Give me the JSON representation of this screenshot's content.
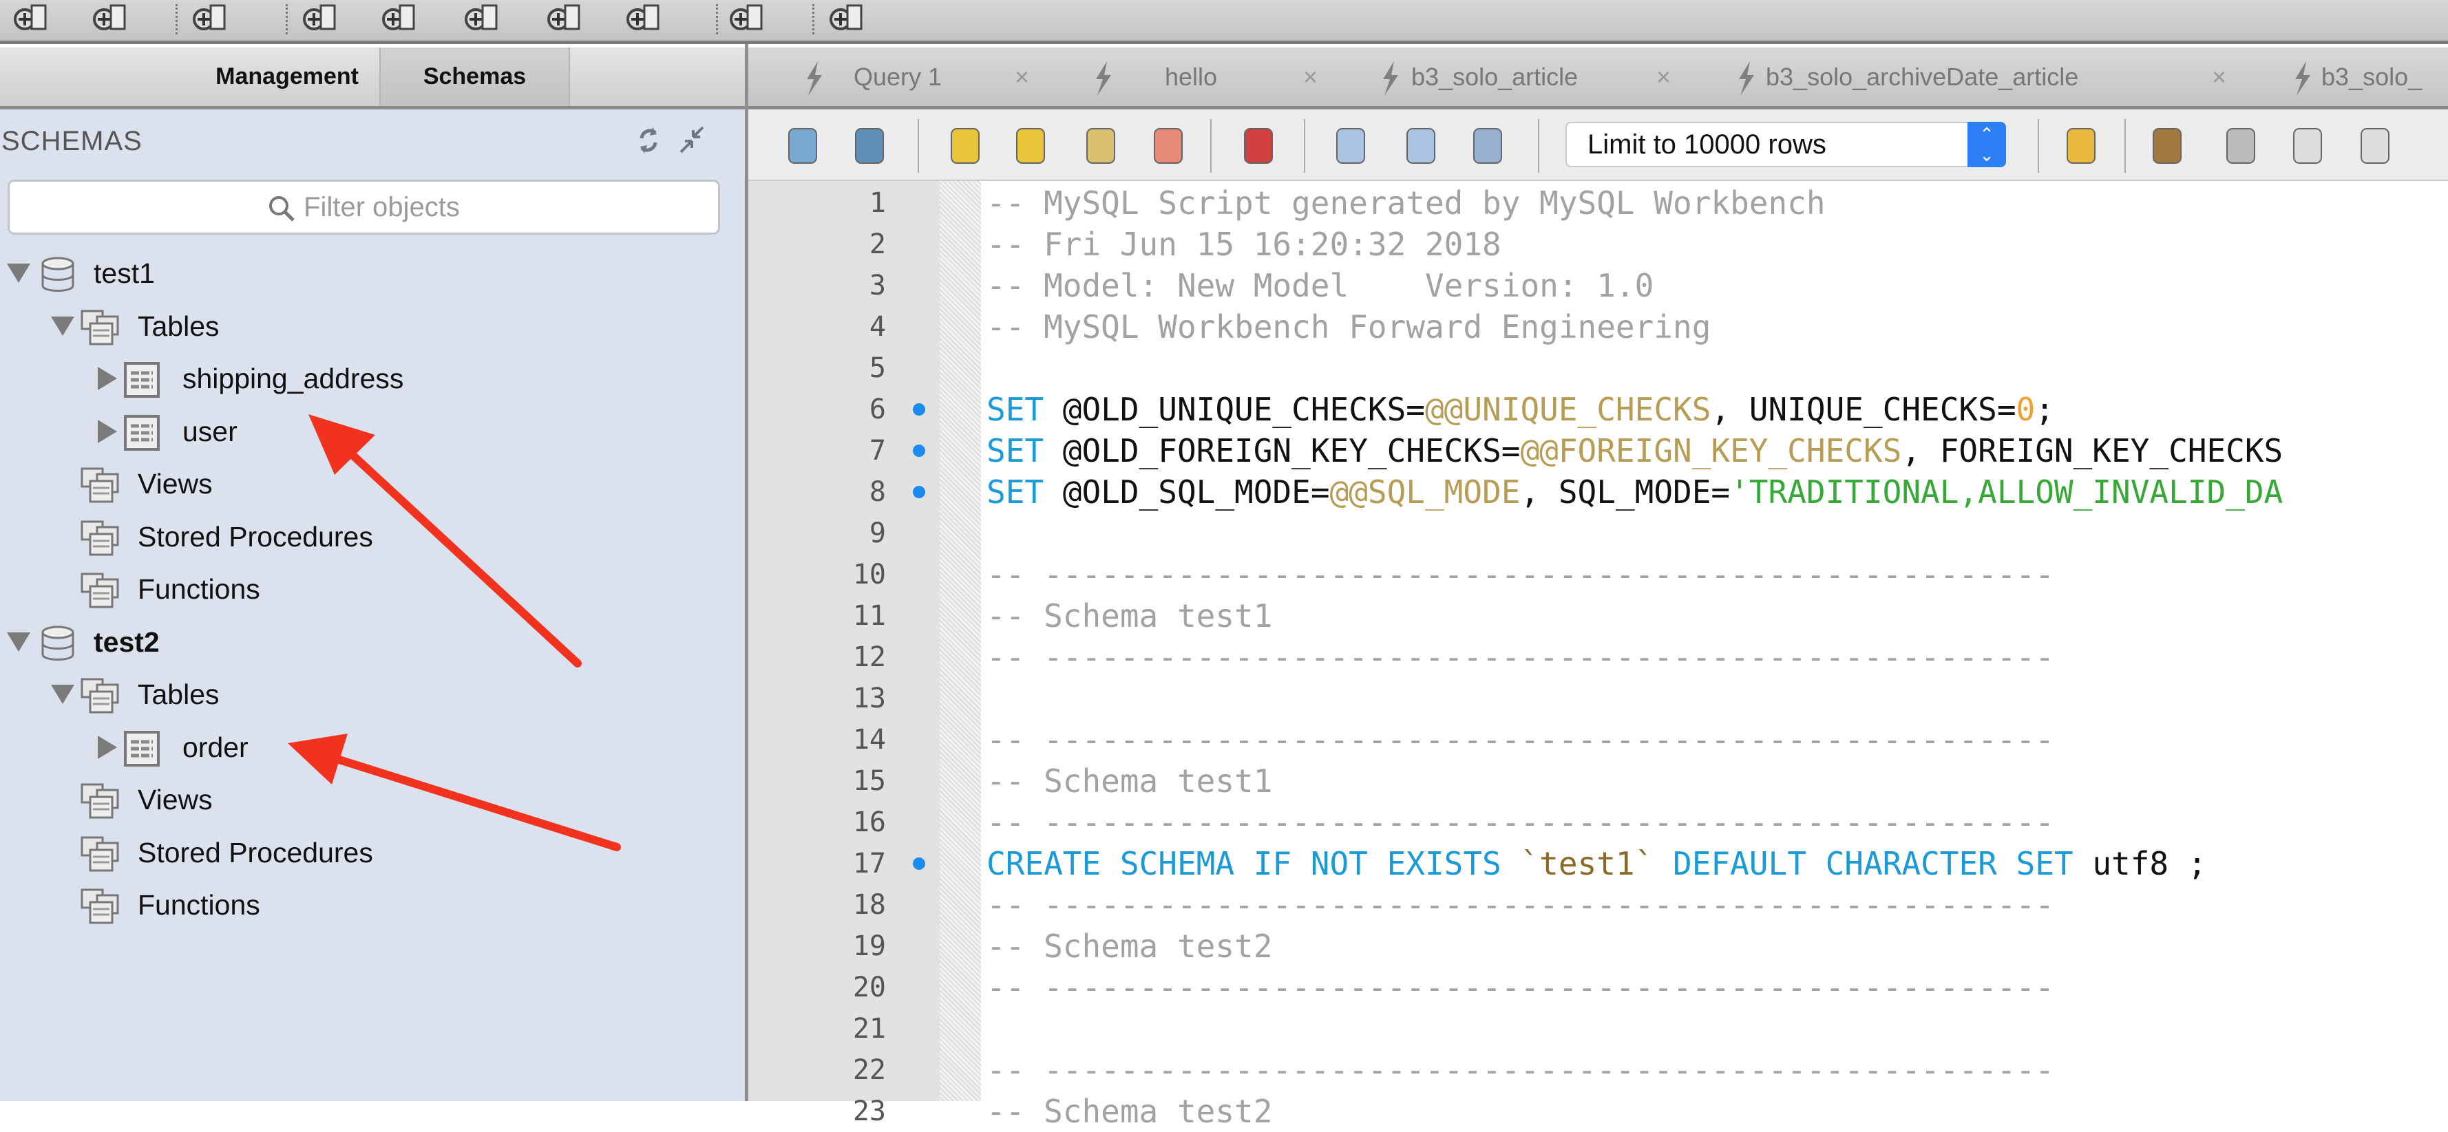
{
  "toolbar": {
    "icons": [
      "new-sql-tab-icon",
      "open-sql-file-icon",
      "inspector-icon",
      "create-schema-icon",
      "create-table-icon",
      "create-view-icon",
      "create-procedure-icon",
      "create-function-icon",
      "search-table-data-icon",
      "reconnect-icon"
    ]
  },
  "sidebar": {
    "tabs": [
      {
        "label": "Management"
      },
      {
        "label": "Schemas",
        "selected": true
      }
    ],
    "title": "SCHEMAS",
    "filter_placeholder": "Filter objects",
    "tree": [
      {
        "level": 0,
        "type": "schema",
        "label": "test1",
        "expanded": true,
        "bold": false
      },
      {
        "level": 1,
        "type": "folder",
        "label": "Tables",
        "expanded": true
      },
      {
        "level": 2,
        "type": "table",
        "label": "shipping_address",
        "expanded": false
      },
      {
        "level": 2,
        "type": "table",
        "label": "user",
        "expanded": false
      },
      {
        "level": 1,
        "type": "folder",
        "label": "Views"
      },
      {
        "level": 1,
        "type": "folder",
        "label": "Stored Procedures"
      },
      {
        "level": 1,
        "type": "folder",
        "label": "Functions"
      },
      {
        "level": 0,
        "type": "schema",
        "label": "test2",
        "expanded": true,
        "bold": true
      },
      {
        "level": 1,
        "type": "folder",
        "label": "Tables",
        "expanded": true
      },
      {
        "level": 2,
        "type": "table",
        "label": "order",
        "expanded": false
      },
      {
        "level": 1,
        "type": "folder",
        "label": "Views"
      },
      {
        "level": 1,
        "type": "folder",
        "label": "Stored Procedures"
      },
      {
        "level": 1,
        "type": "folder",
        "label": "Functions"
      }
    ]
  },
  "editor": {
    "tabs": [
      {
        "label": "Query 1"
      },
      {
        "label": "hello"
      },
      {
        "label": "b3_solo_article"
      },
      {
        "label": "b3_solo_archiveDate_article"
      },
      {
        "label": "b3_solo_"
      }
    ],
    "limit_select": "Limit to 10000 rows",
    "toolbar_icons": [
      "open-file-icon",
      "save-icon",
      "execute-icon",
      "execute-current-icon",
      "explain-icon",
      "stop-icon",
      "toggle-error-stop-icon",
      "commit-icon",
      "rollback-icon",
      "autocommit-icon",
      "add-snippet-icon",
      "beautify-icon",
      "find-icon",
      "invisible-chars-icon",
      "word-wrap-icon"
    ],
    "colors": {
      "keyword": "#1a9ad6",
      "variable": "#b79c54",
      "number": "#f0a030",
      "string": "#36a836",
      "comment": "#a2a2a2",
      "marker": "#1a8cf0",
      "annotation": "#f0321e"
    },
    "lines": [
      {
        "n": "1",
        "tokens": [
          [
            "-- MySQL Script generated by MySQL Workbench",
            "cm"
          ]
        ]
      },
      {
        "n": "2",
        "tokens": [
          [
            "-- Fri Jun 15 16:20:32 2018",
            "cm"
          ]
        ]
      },
      {
        "n": "3",
        "tokens": [
          [
            "-- Model: New Model    Version: 1.0",
            "cm"
          ]
        ]
      },
      {
        "n": "4",
        "tokens": [
          [
            "-- MySQL Workbench Forward Engineering",
            "cm"
          ]
        ]
      },
      {
        "n": "5",
        "tokens": []
      },
      {
        "n": "6",
        "marker": true,
        "tokens": [
          [
            "SET",
            "kw"
          ],
          [
            " @OLD_UNIQUE_CHECKS=",
            "tx"
          ],
          [
            "@@UNIQUE_CHECKS",
            "var"
          ],
          [
            ", UNIQUE_CHECKS=",
            "tx"
          ],
          [
            "0",
            "num"
          ],
          [
            ";",
            "tx"
          ]
        ]
      },
      {
        "n": "7",
        "marker": true,
        "tokens": [
          [
            "SET",
            "kw"
          ],
          [
            " @OLD_FOREIGN_KEY_CHECKS=",
            "tx"
          ],
          [
            "@@FOREIGN_KEY_CHECKS",
            "var"
          ],
          [
            ", FOREIGN_KEY_CHECKS",
            "tx"
          ]
        ]
      },
      {
        "n": "8",
        "marker": true,
        "tokens": [
          [
            "SET",
            "kw"
          ],
          [
            " @OLD_SQL_MODE=",
            "tx"
          ],
          [
            "@@SQL_MODE",
            "var"
          ],
          [
            ", SQL_MODE=",
            "tx"
          ],
          [
            "'TRADITIONAL,ALLOW_INVALID_DA",
            "str"
          ]
        ]
      },
      {
        "n": "9",
        "tokens": []
      },
      {
        "n": "10",
        "tokens": [
          [
            "-- -----------------------------------------------------",
            "cm"
          ]
        ]
      },
      {
        "n": "11",
        "tokens": [
          [
            "-- Schema test1",
            "cm"
          ]
        ]
      },
      {
        "n": "12",
        "tokens": [
          [
            "-- -----------------------------------------------------",
            "cm"
          ]
        ]
      },
      {
        "n": "13",
        "tokens": []
      },
      {
        "n": "14",
        "tokens": [
          [
            "-- -----------------------------------------------------",
            "cm"
          ]
        ]
      },
      {
        "n": "15",
        "tokens": [
          [
            "-- Schema test1",
            "cm"
          ]
        ]
      },
      {
        "n": "16",
        "tokens": [
          [
            "-- -----------------------------------------------------",
            "cm"
          ]
        ]
      },
      {
        "n": "17",
        "marker": true,
        "tokens": [
          [
            "CREATE SCHEMA IF NOT EXISTS ",
            "kw"
          ],
          [
            "`test1`",
            "bt"
          ],
          [
            " DEFAULT CHARACTER SET ",
            "kw"
          ],
          [
            "utf8 ;",
            "tx"
          ]
        ]
      },
      {
        "n": "18",
        "tokens": [
          [
            "-- -----------------------------------------------------",
            "cm"
          ]
        ]
      },
      {
        "n": "19",
        "tokens": [
          [
            "-- Schema test2",
            "cm"
          ]
        ]
      },
      {
        "n": "20",
        "tokens": [
          [
            "-- -----------------------------------------------------",
            "cm"
          ]
        ]
      },
      {
        "n": "21",
        "tokens": []
      },
      {
        "n": "22",
        "tokens": [
          [
            "-- -----------------------------------------------------",
            "cm"
          ]
        ]
      },
      {
        "n": "23",
        "tokens": [
          [
            "-- Schema test2",
            "cm"
          ]
        ]
      }
    ]
  }
}
